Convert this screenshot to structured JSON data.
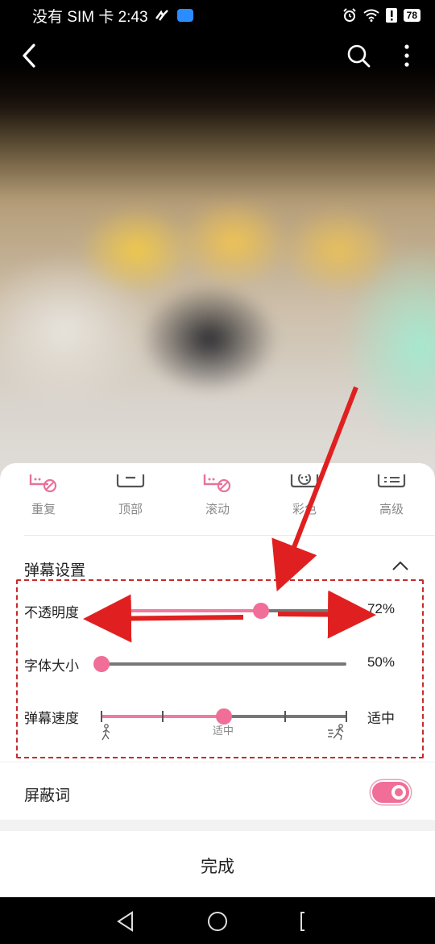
{
  "status_bar": {
    "carrier_time": "没有 SIM 卡 2:43",
    "battery": "78"
  },
  "modes": [
    {
      "label": "重复",
      "icon": "repeat-block-icon"
    },
    {
      "label": "顶部",
      "icon": "top-danmaku-icon"
    },
    {
      "label": "滚动",
      "icon": "scroll-block-icon"
    },
    {
      "label": "彩色",
      "icon": "color-icon"
    },
    {
      "label": "高级",
      "icon": "advanced-icon"
    }
  ],
  "settings": {
    "title": "弹幕设置",
    "opacity": {
      "label": "不透明度",
      "value": "72%",
      "level": 0.65
    },
    "font_size": {
      "label": "字体大小",
      "value": "50%",
      "level": 0.0
    },
    "speed": {
      "label": "弹幕速度",
      "value": "适中",
      "level": 0.5,
      "caption": "适中"
    }
  },
  "block_words": {
    "label": "屏蔽词",
    "enabled": true
  },
  "done_label": "完成",
  "colors": {
    "accent": "#f06e98",
    "annotation": "#e02020"
  }
}
